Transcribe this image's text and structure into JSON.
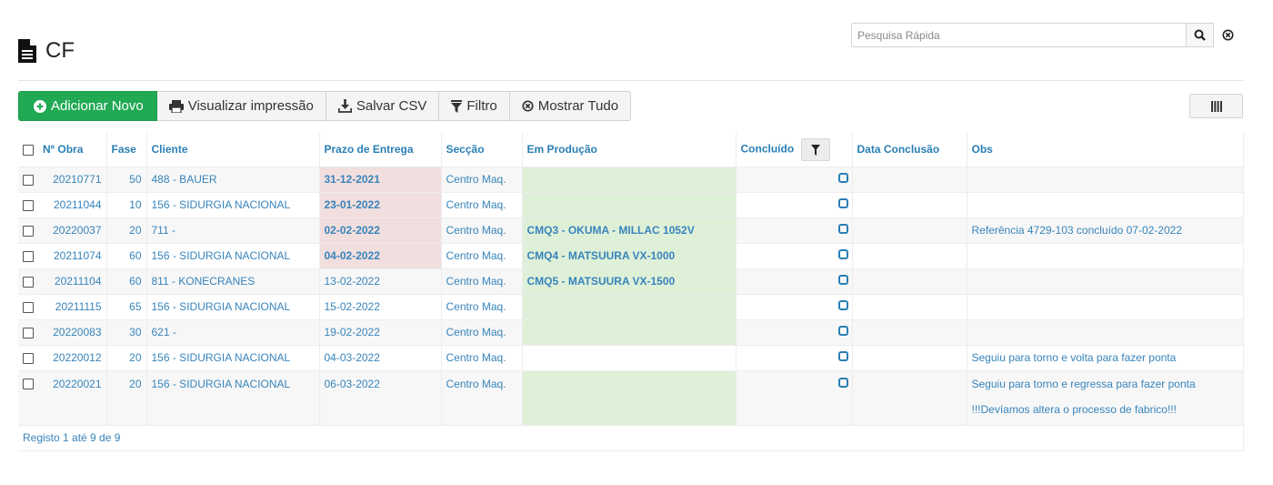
{
  "page": {
    "title": "CF",
    "title_icon": "file-text-icon"
  },
  "search": {
    "placeholder": "Pesquisa Rápida",
    "value": ""
  },
  "toolbar": {
    "add_label": "Adicionar Novo",
    "print_label": "Visualizar impressão",
    "csv_label": "Salvar CSV",
    "filter_label": "Filtro",
    "show_all_label": "Mostrar Tudo"
  },
  "colors": {
    "add_button": "#21a954",
    "link": "#3784bb",
    "late": "#f1dede",
    "production": "#dff0d8"
  },
  "table": {
    "headers": {
      "obra": "Nº Obra",
      "fase": "Fase",
      "cliente": "Cliente",
      "prazo": "Prazo de Entrega",
      "seccao": "Secção",
      "producao": "Em Produção",
      "concluido": "Concluído",
      "data_conclusao": "Data Conclusão",
      "obs": "Obs"
    },
    "rows": [
      {
        "obra": "20210771",
        "fase": "50",
        "cliente": "488 - BAUER",
        "prazo": "31-12-2021",
        "seccao": "Centro Maq.",
        "producao": "",
        "data_conclusao": "",
        "obs": ""
      },
      {
        "obra": "20211044",
        "fase": "10",
        "cliente": "156 - SIDURGIA NACIONAL",
        "prazo": "23-01-2022",
        "seccao": "Centro Maq.",
        "producao": "",
        "data_conclusao": "",
        "obs": ""
      },
      {
        "obra": "20220037",
        "fase": "20",
        "cliente": "711 -",
        "prazo": "02-02-2022",
        "seccao": "Centro Maq.",
        "producao": "CMQ3 - OKUMA - MILLAC 1052V",
        "data_conclusao": "",
        "obs": "Referência 4729-103 concluído 07-02-2022"
      },
      {
        "obra": "20211074",
        "fase": "60",
        "cliente": "156 - SIDURGIA NACIONAL",
        "prazo": "04-02-2022",
        "seccao": "Centro Maq.",
        "producao": "CMQ4 - MATSUURA VX-1000",
        "data_conclusao": "",
        "obs": ""
      },
      {
        "obra": "20211104",
        "fase": "60",
        "cliente": "811 - KONECRANES",
        "prazo": "13-02-2022",
        "seccao": "Centro Maq.",
        "producao": "CMQ5 - MATSUURA VX-1500",
        "data_conclusao": "",
        "obs": ""
      },
      {
        "obra": "20211115",
        "fase": "65",
        "cliente": "156 - SIDURGIA NACIONAL",
        "prazo": "15-02-2022",
        "seccao": "Centro Maq.",
        "producao": "",
        "data_conclusao": "",
        "obs": ""
      },
      {
        "obra": "20220083",
        "fase": "30",
        "cliente": "621 -",
        "prazo": "19-02-2022",
        "seccao": "Centro Maq.",
        "producao": "",
        "data_conclusao": "",
        "obs": ""
      },
      {
        "obra": "20220012",
        "fase": "20",
        "cliente": "156 - SIDURGIA NACIONAL",
        "prazo": "04-03-2022",
        "seccao": "Centro Maq.",
        "producao": "",
        "data_conclusao": "",
        "obs": "Seguiu para torno e volta para fazer ponta"
      },
      {
        "obra": "20220021",
        "fase": "20",
        "cliente": "156 - SIDURGIA NACIONAL",
        "prazo": "06-03-2022",
        "seccao": "Centro Maq.",
        "producao": "",
        "data_conclusao": "",
        "obs": "Seguiu para torno e regressa para fazer ponta",
        "obs2": "!!!Devíamos altera o processo de fabrico!!!"
      }
    ],
    "footer": "Registo 1 até 9 de 9"
  }
}
